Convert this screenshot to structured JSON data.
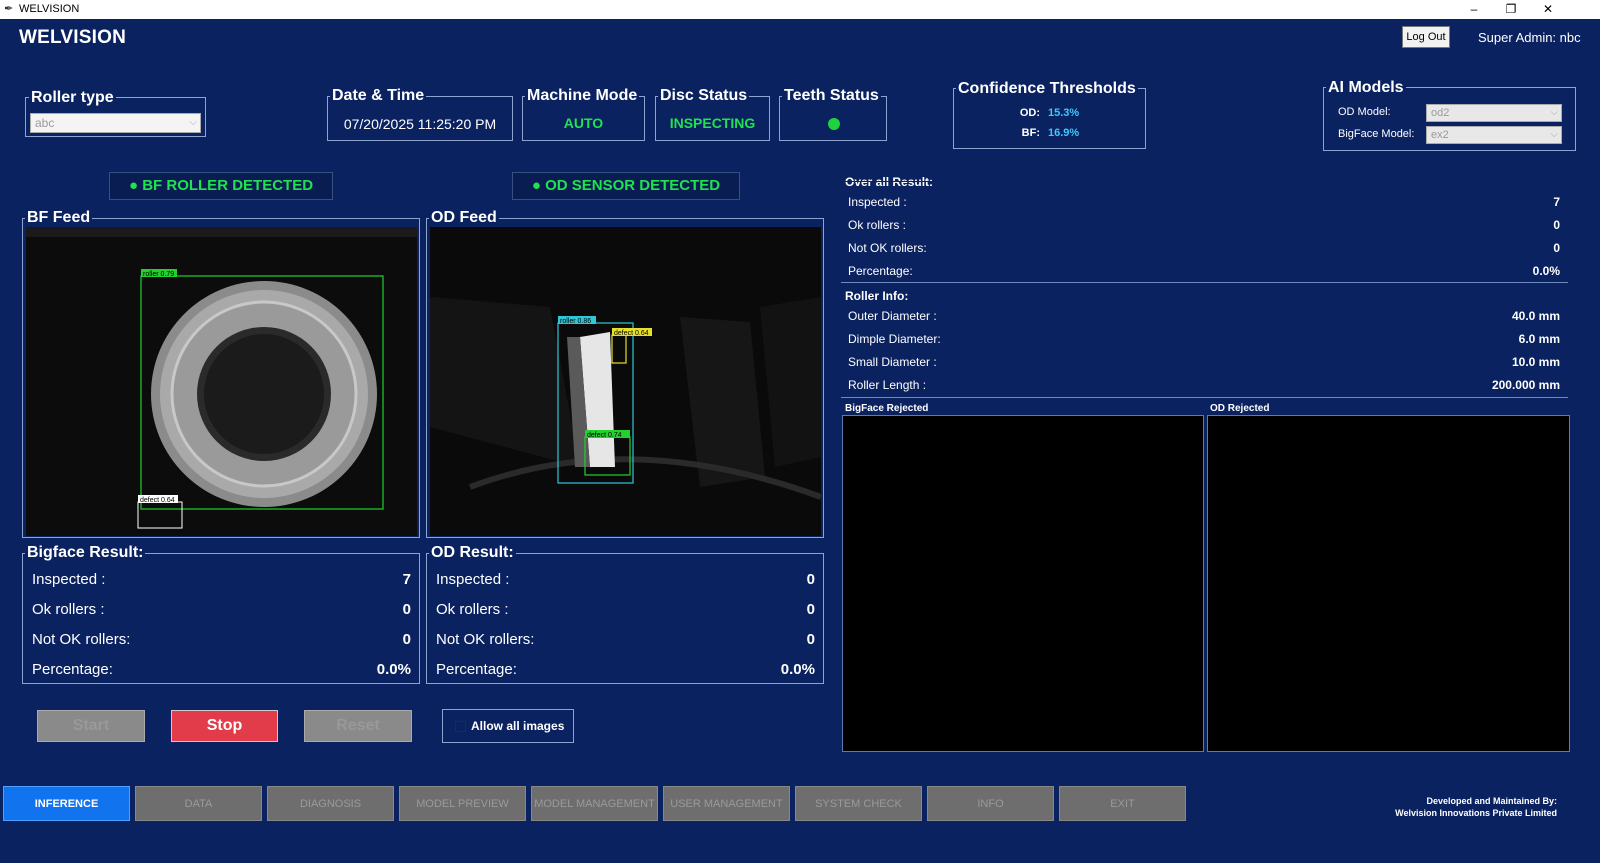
{
  "window": {
    "title": "WELVISION",
    "minimize": "–",
    "maximize": "❐",
    "close": "✕"
  },
  "header": {
    "brand": "WELVISION",
    "logout_label": "Log Out",
    "user": "Super Admin: nbc"
  },
  "roller_type": {
    "label": "Roller type",
    "value": "abc"
  },
  "datetime": {
    "label": "Date & Time",
    "value": "07/20/2025 11:25:20 PM"
  },
  "machine_mode": {
    "label": "Machine Mode",
    "value": "AUTO"
  },
  "disc_status": {
    "label": "Disc Status",
    "value": "INSPECTING"
  },
  "teeth_status": {
    "label": "Teeth Status",
    "indicator_color": "#1fd33c"
  },
  "confidence": {
    "label": "Confidence Thresholds",
    "od_label": "OD:",
    "od_value": "15.3%",
    "bf_label": "BF:",
    "bf_value": "16.9%"
  },
  "ai_models": {
    "label": "AI Models",
    "od_label": "OD Model:",
    "od_value": "od2",
    "bf_label": "BigFace Model:",
    "bf_value": "ex2"
  },
  "detections": {
    "bf": "● BF ROLLER DETECTED",
    "od": "● OD SENSOR DETECTED"
  },
  "bf_feed": {
    "label": "BF Feed",
    "box_roller": "roller 0.79",
    "box_defect": "defect 0.64"
  },
  "od_feed": {
    "label": "OD Feed",
    "box_roller": "roller 0.86",
    "box_defect1": "defect 0.64",
    "box_defect2": "defect 0.74"
  },
  "bigface_result": {
    "label": "Bigface Result:",
    "rows": [
      {
        "label": "Inspected :",
        "value": "7"
      },
      {
        "label": "Ok rollers :",
        "value": "0"
      },
      {
        "label": "Not OK rollers:",
        "value": "0"
      },
      {
        "label": "Percentage:",
        "value": "0.0%"
      }
    ]
  },
  "od_result": {
    "label": "OD Result:",
    "rows": [
      {
        "label": "Inspected :",
        "value": "0"
      },
      {
        "label": "Ok rollers :",
        "value": "0"
      },
      {
        "label": "Not OK rollers:",
        "value": "0"
      },
      {
        "label": "Percentage:",
        "value": "0.0%"
      }
    ]
  },
  "controls": {
    "start": "Start",
    "stop": "Stop",
    "reset": "Reset",
    "allow_all": "Allow all images"
  },
  "overall": {
    "label": "Over all Result:",
    "rows": [
      {
        "label": "Inspected :",
        "value": "7"
      },
      {
        "label": "Ok rollers :",
        "value": "0"
      },
      {
        "label": "Not OK rollers:",
        "value": "0"
      },
      {
        "label": "Percentage:",
        "value": "0.0%"
      }
    ]
  },
  "roller_info": {
    "label": "Roller Info:",
    "rows": [
      {
        "label": "Outer Diameter :",
        "value": "40.0 mm"
      },
      {
        "label": "Dimple Diameter:",
        "value": "6.0 mm"
      },
      {
        "label": "Small Diameter :",
        "value": "10.0 mm"
      },
      {
        "label": "Roller Length :",
        "value": "200.000 mm"
      }
    ]
  },
  "rejected": {
    "bigface": "BigFace Rejected",
    "od": "OD Rejected"
  },
  "nav": [
    "INFERENCE",
    "DATA",
    "DIAGNOSIS",
    "MODEL PREVIEW",
    "MODEL MANAGEMENT",
    "USER MANAGEMENT",
    "SYSTEM CHECK",
    "INFO",
    "EXIT"
  ],
  "footer": {
    "line1": "Developed and Maintained By:",
    "line2": "Welvision Innovations Private Limited"
  }
}
